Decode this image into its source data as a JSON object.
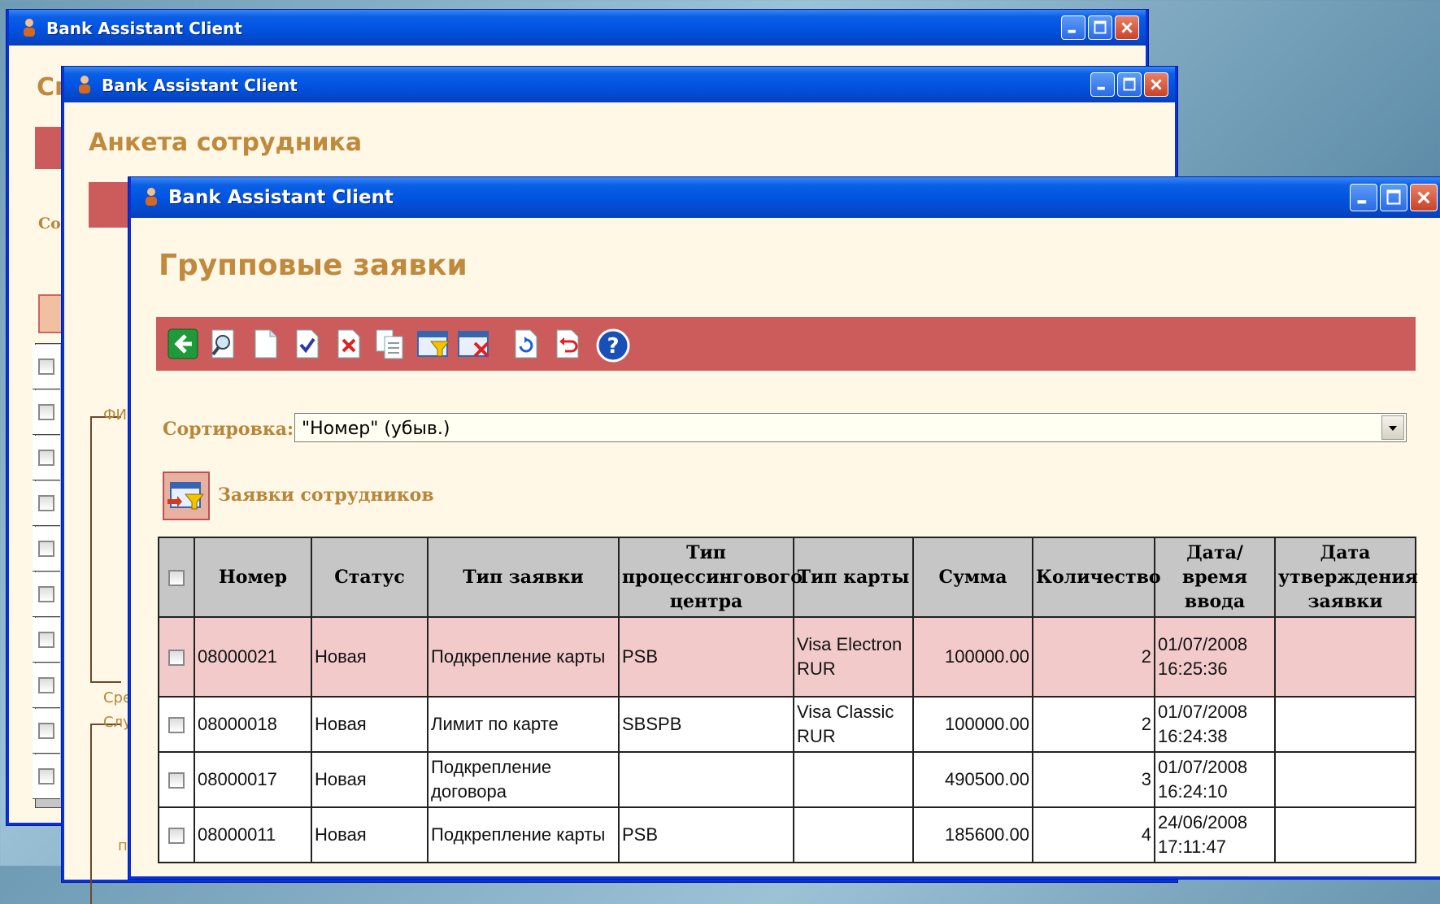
{
  "window_title": "Bank Assistant Client",
  "back_window_1": {
    "title_fragment": "Сп",
    "label_fragment": "Со"
  },
  "back_window_2": {
    "page_title": "Анкета сотрудника",
    "fragments": [
      "ФИ",
      "Сре",
      "Слу",
      "п"
    ]
  },
  "front_window": {
    "page_title": "Групповые заявки",
    "toolbar": [
      {
        "icon": "back-arrow-icon"
      },
      {
        "icon": "view-icon"
      },
      {
        "icon": "new-document-icon"
      },
      {
        "icon": "approve-check-icon"
      },
      {
        "icon": "delete-icon"
      },
      {
        "icon": "copy-icon"
      },
      {
        "icon": "filter-icon"
      },
      {
        "icon": "clear-filter-icon"
      },
      {
        "icon": "refresh-icon"
      },
      {
        "icon": "undo-icon"
      },
      {
        "icon": "help-icon"
      }
    ],
    "sort": {
      "label": "Сортировка:",
      "value": "\"Номер\" (убыв.)"
    },
    "section_title": "Заявки сотрудников",
    "table": {
      "headers": [
        "Номер",
        "Статус",
        "Тип заявки",
        "Тип процессингового центра",
        "Тип карты",
        "Сумма",
        "Количество",
        "Дата/время ввода",
        "Дата утверждения заявки"
      ],
      "rows": [
        {
          "number": "08000021",
          "status": "Новая",
          "type": "Подкрепление карты",
          "center": "PSB",
          "card": "Visa Electron RUR",
          "sum": "100000.00",
          "qty": "2",
          "date": "01/07/2008",
          "time": "16:25:36",
          "approved": "",
          "selected": true
        },
        {
          "number": "08000018",
          "status": "Новая",
          "type": "Лимит по карте",
          "center": "SBSPB",
          "card": "Visa Classic RUR",
          "sum": "100000.00",
          "qty": "2",
          "date": "01/07/2008",
          "time": "16:24:38",
          "approved": "",
          "selected": false
        },
        {
          "number": "08000017",
          "status": "Новая",
          "type": "Подкрепление договора",
          "center": "",
          "card": "",
          "sum": "490500.00",
          "qty": "3",
          "date": "01/07/2008",
          "time": "16:24:10",
          "approved": "",
          "selected": false
        },
        {
          "number": "08000011",
          "status": "Новая",
          "type": "Подкрепление карты",
          "center": "PSB",
          "card": "",
          "sum": "185600.00",
          "qty": "4",
          "date": "24/06/2008",
          "time": "17:11:47",
          "approved": "",
          "selected": false
        }
      ]
    }
  },
  "colors": {
    "title_bar": "#0254e3",
    "window_bg": "#fff8e6",
    "toolbar": "#cc5c5c",
    "heading": "#c08a3e",
    "selected_row": "#f2caca"
  }
}
